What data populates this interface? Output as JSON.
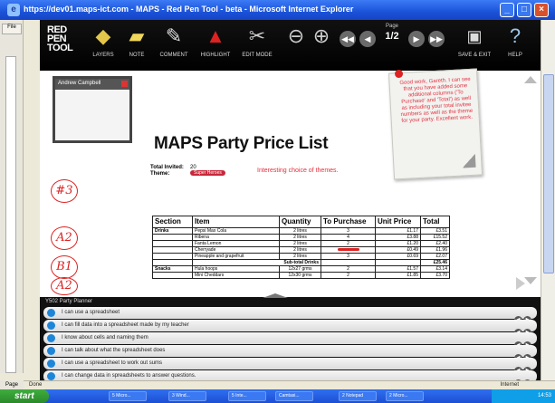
{
  "window": {
    "title": "https://dev01.maps-ict.com - MAPS - Red Pen Tool - beta - Microsoft Internet Explorer",
    "statusbar_left": "Done",
    "statusbar_zone": "Internet",
    "page_tab": "Page"
  },
  "toolbar": {
    "logo": [
      "RED",
      "PEN",
      "TOOL"
    ],
    "layers_label": "LAYERS",
    "note_label": "NOTE",
    "comment_label": "COMMENT",
    "highlight_label": "HIGHLIGHT",
    "edit_mode_label": "EDIT MODE",
    "page_label": "Page",
    "page_value": "1/2",
    "save_exit_label": "SAVE & EXIT",
    "help_label": "HELP"
  },
  "document": {
    "student_name": "Andrew Campbell",
    "title": "MAPS Party Price List",
    "total_invited_label": "Total Invited:",
    "total_invited_value": "20",
    "theme_label": "Theme:",
    "theme_value": "Super Heroes",
    "theme_comment": "Interesting choice of themes.",
    "sticky_note": "Good work, Gareth.  I can see that you have added some additional columns ('To Purchase' and 'Total') as well as including your total invitee numbers as well as the theme for your party.  Excellent work.",
    "margin_marks": [
      "#3",
      "A2",
      "B1",
      "A2"
    ]
  },
  "table": {
    "headers": [
      "Section",
      "Item",
      "Quantity",
      "To Purchase",
      "Unit Price",
      "Total"
    ],
    "rows": [
      {
        "section": "Drinks",
        "item": "Pepsi Max Cola",
        "qty": "2 litres",
        "purchase": "3",
        "unit": "£1.17",
        "total": "£3.51"
      },
      {
        "section": "",
        "item": "Ribena",
        "qty": "2 litres",
        "purchase": "4",
        "unit": "£3.88",
        "total": "£15.52"
      },
      {
        "section": "",
        "item": "Fanta Lemon",
        "qty": "2 litres",
        "purchase": "2",
        "unit": "£1.20",
        "total": "£2.40"
      },
      {
        "section": "",
        "item": "Cherryade",
        "qty": "2 litres",
        "purchase": "",
        "unit": "£0.49",
        "total": "£1.96"
      },
      {
        "section": "",
        "item": "Pineapple and grapefruit",
        "qty": "2 litres",
        "purchase": "3",
        "unit": "£0.69",
        "total": "£2.07"
      },
      {
        "section": "",
        "item": "Sub-total Drinks",
        "qty": "",
        "purchase": "",
        "unit": "",
        "total": "£25.46"
      },
      {
        "section": "Snacks",
        "item": "Hula hoops",
        "qty": "12x27 grms",
        "purchase": "2",
        "unit": "£1.57",
        "total": "£3.14"
      },
      {
        "section": "",
        "item": "Mini Cheddars",
        "qty": "12x30 grms",
        "purchase": "2",
        "unit": "£1.85",
        "total": "£3.70"
      }
    ]
  },
  "planner": {
    "title": "Y502 Party Planner",
    "items": [
      "I can use a spreadsheet",
      "I can fill data into a spreadsheet made by my teacher",
      "I know about cells and naming them",
      "I can talk about what the spreadsheet does",
      "I can use a spreadsheet to work out sums",
      "I can change data in spreadsheets to answer questions."
    ]
  },
  "taskbar": {
    "start": "start",
    "tasks": [
      "5 Micro...",
      "3 Wind...",
      "5 Inte...",
      "Camtasi...",
      "2 Notepad",
      "2 Micro..."
    ],
    "clock": "14:53"
  }
}
